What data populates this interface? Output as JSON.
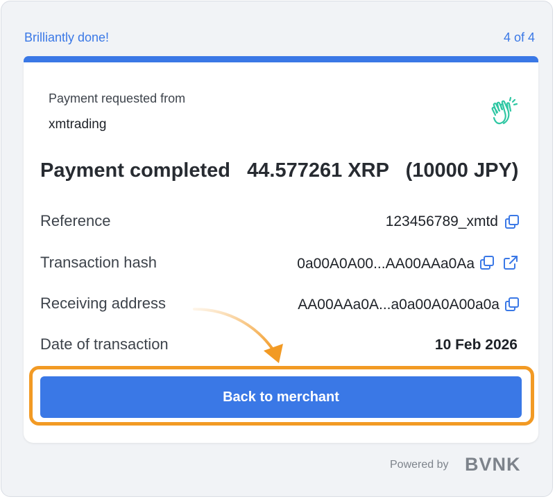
{
  "progress": {
    "title": "Brilliantly done!",
    "step": "4 of 4"
  },
  "card": {
    "request_label": "Payment requested from",
    "merchant": "xmtrading",
    "headline": {
      "prefix": "Payment completed",
      "crypto_amount": "44.577261 XRP",
      "fiat_amount": "(10000 JPY)"
    },
    "rows": [
      {
        "label": "Reference",
        "value": "123456789_xmtd",
        "icons": [
          "copy-icon"
        ]
      },
      {
        "label": "Transaction hash",
        "value": "0a00A0A00...AA00AAa0Aa",
        "icons": [
          "copy-icon",
          "external-link-icon"
        ]
      },
      {
        "label": "Receiving address",
        "value": "AA00AAa0A...a0a00A0A00a0a",
        "icons": [
          "copy-icon"
        ]
      },
      {
        "label": "Date of transaction",
        "value": "10 Feb 2026",
        "icons": []
      }
    ],
    "back_button": "Back to merchant"
  },
  "footer": {
    "powered_by": "Powered by",
    "brand": "BVNK"
  },
  "colors": {
    "accent": "#3a78e6",
    "highlight": "#f29a24",
    "icon_teal": "#2fc7a3"
  }
}
